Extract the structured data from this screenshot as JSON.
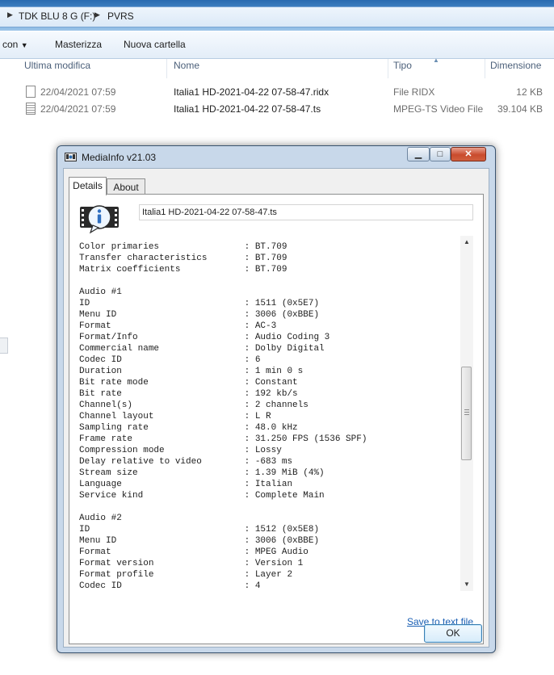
{
  "explorer": {
    "breadcrumb": [
      "TDK BLU 8 G (F:)",
      "PVRS"
    ],
    "toolbar": {
      "share_label": "con",
      "burn_label": "Masterizza",
      "new_folder_label": "Nuova cartella"
    },
    "columns": {
      "modified": "Ultima modifica",
      "name": "Nome",
      "type": "Tipo",
      "size": "Dimensione"
    },
    "files": [
      {
        "date": "22/04/2021 07:59",
        "name": "Italia1 HD-2021-04-22 07-58-47.ridx",
        "type": "File RIDX",
        "size": "12 KB",
        "icon": "file-icon"
      },
      {
        "date": "22/04/2021 07:59",
        "name": "Italia1 HD-2021-04-22 07-58-47.ts",
        "type": "MPEG-TS Video File",
        "size": "39.104 KB",
        "icon": "video-file-icon"
      }
    ]
  },
  "mediainfo": {
    "title": "MediaInfo v21.03",
    "tabs": [
      "Details",
      "About"
    ],
    "filename": "Italia1 HD-2021-04-22 07-58-47.ts",
    "lines": [
      "Color primaries                : BT.709",
      "Transfer characteristics       : BT.709",
      "Matrix coefficients            : BT.709",
      "",
      "Audio #1",
      "ID                             : 1511 (0x5E7)",
      "Menu ID                        : 3006 (0xBBE)",
      "Format                         : AC-3",
      "Format/Info                    : Audio Coding 3",
      "Commercial name                : Dolby Digital",
      "Codec ID                       : 6",
      "Duration                       : 1 min 0 s",
      "Bit rate mode                  : Constant",
      "Bit rate                       : 192 kb/s",
      "Channel(s)                     : 2 channels",
      "Channel layout                 : L R",
      "Sampling rate                  : 48.0 kHz",
      "Frame rate                     : 31.250 FPS (1536 SPF)",
      "Compression mode               : Lossy",
      "Delay relative to video        : -683 ms",
      "Stream size                    : 1.39 MiB (4%)",
      "Language                       : Italian",
      "Service kind                   : Complete Main",
      "",
      "Audio #2",
      "ID                             : 1512 (0x5E8)",
      "Menu ID                        : 3006 (0xBBE)",
      "Format                         : MPEG Audio",
      "Format version                 : Version 1",
      "Format profile                 : Layer 2",
      "Codec ID                       : 4"
    ],
    "save_link": "Save to text file",
    "ok_label": "OK"
  }
}
